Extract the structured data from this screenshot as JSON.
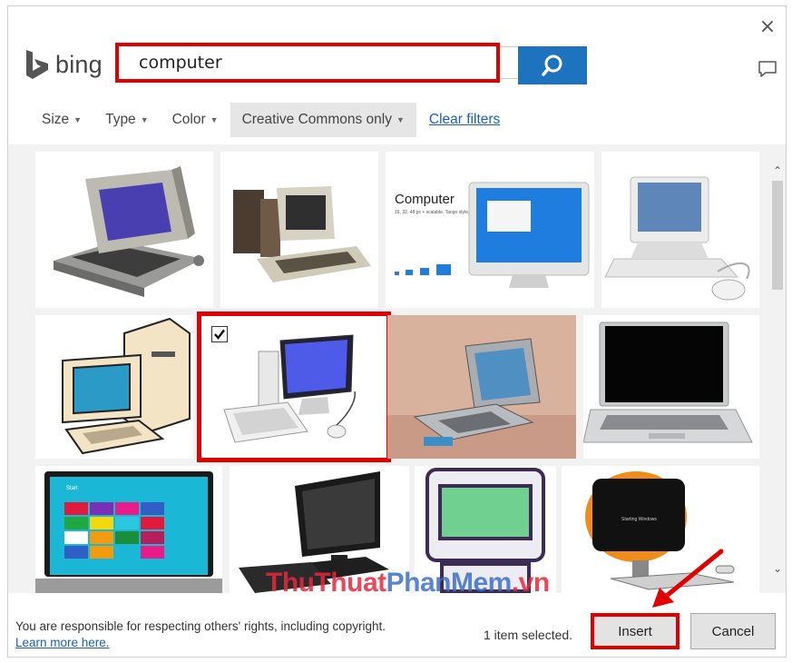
{
  "header": {
    "logo_text": "bing",
    "close_glyph": "×",
    "feedback_icon": "speech-bubble-icon"
  },
  "search": {
    "query": "computer",
    "button_icon": "search-icon"
  },
  "filters": {
    "size_label": "Size",
    "type_label": "Type",
    "color_label": "Color",
    "license_label": "Creative Commons only",
    "clear_label": "Clear filters"
  },
  "results": {
    "images": [
      {
        "label": "retro-terminal-computer"
      },
      {
        "label": "vintage-home-computer"
      },
      {
        "label": "computer-icon-set",
        "caption_title": "Computer",
        "caption_text": "16, 32, 48 px + scalable. Tango style."
      },
      {
        "label": "white-crt-computer"
      },
      {
        "label": "clipart-desktop-computer"
      },
      {
        "label": "flat-monitor-keyboard-mouse",
        "selected": true
      },
      {
        "label": "grey-laptop-on-table"
      },
      {
        "label": "black-laptop-open"
      },
      {
        "label": "windows-start-laptop",
        "screen_text": "Start"
      },
      {
        "label": "black-lcd-desktop"
      },
      {
        "label": "green-screen-computer-icon"
      },
      {
        "label": "orange-crt-computer",
        "screen_text": "Starting Windows"
      }
    ]
  },
  "watermark": {
    "part1": "ThuThuat",
    "part2": "PhanMem",
    "part3": ".vn"
  },
  "footer": {
    "notice_text": "You are responsible for respecting others' rights, including copyright.",
    "notice_link": "Learn more here.",
    "selected_text": "1 item selected.",
    "insert_label": "Insert",
    "cancel_label": "Cancel"
  },
  "colors": {
    "accent": "#1e73be",
    "highlight": "#e00000",
    "link": "#1c5fb8"
  }
}
